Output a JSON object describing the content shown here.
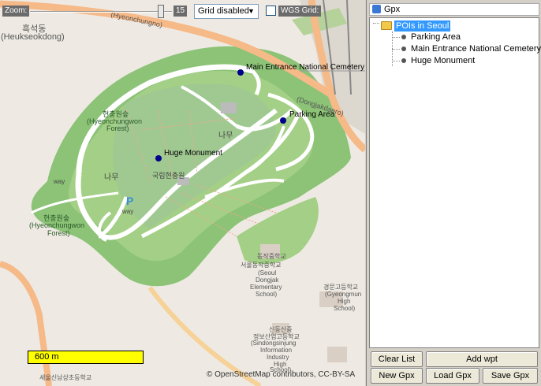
{
  "toolbar": {
    "zoom_label": "Zoom:",
    "zoom_value": "15",
    "zoom_level": 15,
    "grid_select_value": "Grid disabled",
    "wgs_grid_label": "WGS Grid:",
    "wgs_grid_checked": false
  },
  "map": {
    "labels": {
      "heukseokdong_ko": "흑석동",
      "heukseokdong_en": "(Heukseokdong)",
      "hyeonchungno_road": "(Hyeonchungno)",
      "dongjakdaero_road": "(Dongjakdaero)",
      "hyeonchungwon_forest_ko_1": "현충원숲",
      "hyeonchungwon_forest_en_1a": "(Hyeonchungwon",
      "hyeonchungwon_forest_en_1b": "Forest)",
      "hyeonchungwon_forest_ko_2": "현충원숲",
      "hyeonchungwon_forest_en_2a": "(Hyeonchungwon",
      "hyeonchungwon_forest_en_2b": "Forest)",
      "namu_1": "나무",
      "namu_2": "나무",
      "cemetery_ko": "국립현충원",
      "way_1": "way",
      "way_2": "way",
      "parking_p": "P",
      "middle_school_ko": "동작중학교",
      "middle_school_ko2": "서울동작중학교",
      "middle_school_en": "(Seoul",
      "middle_school_en2": "Dongjak",
      "middle_school_en3": "Elementary",
      "middle_school_en4": "School)",
      "high_school_ko": "경문고등학교",
      "high_school_en": "(Gyeongmun",
      "high_school_en2": "High",
      "high_school_en3": "School)",
      "info_school_ko": "신동신중",
      "info_school_ko2": "정보산업고등학교",
      "info_school_en": "(Sindongsinjung",
      "info_school_en2": "Information",
      "info_school_en3": "Industry",
      "info_school_en4": "High",
      "info_school_en5": "School)",
      "bottom_school_ko": "세울신남상초등학교"
    },
    "pois": [
      {
        "name": "Main Entrance National Cemetery"
      },
      {
        "name": "Parking Area"
      },
      {
        "name": "Huge Monument"
      }
    ],
    "scale_label": "600 m",
    "attribution": "© OpenStreetMap contributors, CC-BY-SA"
  },
  "panel": {
    "title": "Gpx",
    "root_label": "POIs in Seoul",
    "items": [
      {
        "label": "Parking Area"
      },
      {
        "label": "Main Entrance National Cemetery"
      },
      {
        "label": "Huge Monument"
      }
    ],
    "buttons": {
      "clear_list": "Clear List",
      "add_wpt": "Add wpt",
      "new_gpx": "New Gpx",
      "load_gpx": "Load Gpx",
      "save_gpx": "Save Gpx"
    }
  },
  "colors": {
    "forest": "#a3cf86",
    "park_dark": "#8cc377",
    "road": "#ffffff",
    "poi": "#00008b",
    "scale_bar": "#ffff00",
    "selection": "#3399ff"
  }
}
